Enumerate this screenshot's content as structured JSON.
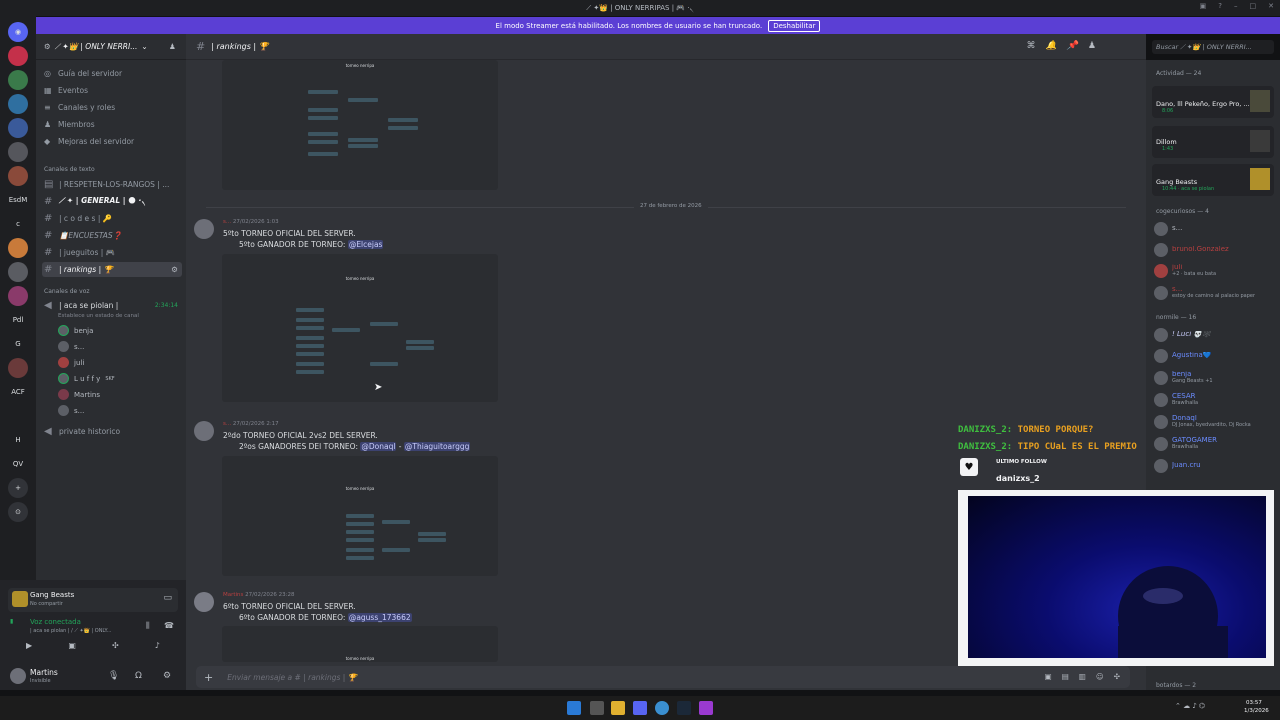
{
  "window": {
    "title": "⟋ ✦👑 | ONLY NERRIPAS | 🎮 ·৲"
  },
  "banner": {
    "text": "El modo Streamer está habilitado. Los nombres de usuario se han truncado.",
    "button": "Deshabilitar"
  },
  "servers": [
    "EsdM",
    "c",
    "Pdl",
    "G",
    "ACF",
    "H",
    "QV"
  ],
  "server": {
    "name": "⟋ ✦👑 | ONLY NERRI..."
  },
  "nav": [
    {
      "label": "Guía del servidor",
      "icon": "compass-icon"
    },
    {
      "label": "Eventos",
      "icon": "calendar-icon"
    },
    {
      "label": "Canales y roles",
      "icon": "list-icon"
    },
    {
      "label": "Miembros",
      "icon": "members-icon"
    },
    {
      "label": "Mejoras del servidor",
      "icon": "boost-icon"
    }
  ],
  "text_category": "Canales de texto",
  "text_channels": [
    {
      "name": "| RESPETEN-LOS-RANGOS | ..."
    },
    {
      "name": "⟋ ✦ | GENERAL | 🌑 ·৲"
    },
    {
      "name": "| c o d e s | 🔑"
    },
    {
      "name": "📋ENCUESTAS❓"
    },
    {
      "name": "| jueguitos | 🎮"
    },
    {
      "name": "| rankings | 🏆"
    }
  ],
  "voice_category": "Canales de voz",
  "voice_channel": {
    "name": "| aca se piolan |",
    "timer": "2:34:14",
    "status": "Establece un estado de canal"
  },
  "voice_users": [
    {
      "name": "benja"
    },
    {
      "name": "s..."
    },
    {
      "name": "juli"
    },
    {
      "name": "L u f f y",
      "badge": "SKF"
    },
    {
      "name": "Martins"
    },
    {
      "name": "s..."
    }
  ],
  "private_channel": "private historico",
  "userpanel": {
    "activity_title": "Gang Beasts",
    "activity_sub": "No compartir",
    "voice_status": "Voz conectada",
    "voice_sub": "| aca se piolan | / ⟋ ✦👑 | ONLY...",
    "username": "Martins",
    "user_status": "Invisible"
  },
  "channel": {
    "name": "| rankings | 🏆",
    "search_placeholder": "Buscar ⟋ ✦👑 | ONLY NERRI..."
  },
  "date_divider": "27 de febrero de 2026",
  "messages": [
    {
      "author": "s...",
      "time": "27/02/2026 1:03",
      "line1": "5ºto TORNEO OFICIAL DEL SERVER.",
      "line2_prefix": "5ºto GANADOR DE TORNEO: ",
      "mention1": "@Elcejas",
      "mention2": ""
    },
    {
      "author": "s...",
      "time": "27/02/2026 2:17",
      "line1": "2ºdo TORNEO OFICIAL 2vs2 DEL SERVER.",
      "line2_prefix": "2ºos GANADORES DEl TORNEO: ",
      "mention1": "@Donaql",
      "mention2": "@Thiaguitoarggg"
    },
    {
      "author": "Martins",
      "time": "27/02/2026 23:28",
      "line1": "6ºto TORNEO OFICIAL DEL SERVER.",
      "line2_prefix": "6ºto GANADOR DE TORNEO: ",
      "mention1": "@aguss_173662",
      "mention2": ""
    }
  ],
  "bracket_title": "torneo nerripa",
  "composer": {
    "placeholder": "Enviar mensaje a # | rankings | 🏆"
  },
  "members": {
    "activity_label": "Actividad — 24",
    "activity_cards": [
      {
        "title": "Dano, lll Pekeño, Ergo Pro, ...",
        "sub": "8:06"
      },
      {
        "title": "Dillom",
        "sub": "1:43"
      },
      {
        "title": "Gang Beasts",
        "sub": "10:44 · aca se piolan"
      }
    ],
    "group1_label": "cogecuriosos — 4",
    "group1": [
      {
        "name": "s...",
        "sub": "",
        "color": "#b5bac1"
      },
      {
        "name": "brunol.Gonzalez",
        "sub": "",
        "color": "#b84040"
      },
      {
        "name": "juli",
        "sub": "+2 · bata eu bata",
        "color": "#b84040"
      },
      {
        "name": "s...",
        "sub": "estoy de camino al palacio paper",
        "color": "#b84040"
      }
    ],
    "group2_label": "normile — 16",
    "group2": [
      {
        "name": "! Luci 💀🕸️",
        "sub": "",
        "color": "#c9cdfb"
      },
      {
        "name": "Agustina💙",
        "sub": "",
        "color": "#6b8cff"
      },
      {
        "name": "benja",
        "sub": "Gang Beasts +1",
        "color": "#6b8cff"
      },
      {
        "name": "CESAR",
        "sub": "Brawlhalla",
        "color": "#6b8cff"
      },
      {
        "name": "Donaql",
        "sub": "DJ Jonax, byedvardito, Dj Rocka",
        "color": "#6b8cff"
      },
      {
        "name": "GATOGAMER",
        "sub": "Brawlhalla",
        "color": "#6b8cff"
      },
      {
        "name": "Juan.cru",
        "sub": "",
        "color": "#6b8cff"
      }
    ],
    "group3_label": "botardos — 2"
  },
  "overlay": {
    "chat": [
      {
        "user": "DANIZXS_2:",
        "text": "TORNEO PORQUE?"
      },
      {
        "user": "DANIZXS_2:",
        "text": "TIPO CUaL ES EL PREMIO"
      }
    ],
    "follow_label": "ULTIMO FOLLOW",
    "follow_name": "danizxs_2"
  },
  "taskbar": {
    "time": "03:57",
    "date": "1/3/2026"
  },
  "colors": {
    "accent": "#5865f2",
    "banner": "#5b3fd4",
    "overlay_user": "#3fbf3f",
    "overlay_text": "#e8a020"
  }
}
